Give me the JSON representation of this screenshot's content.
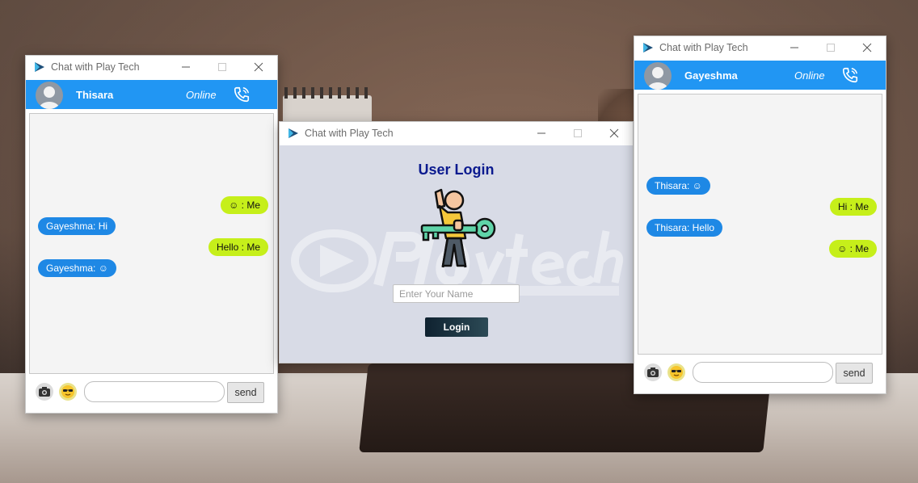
{
  "windows": {
    "left_chat": {
      "title": "Chat with Play Tech",
      "contact_name": "Thisara",
      "status": "Online",
      "messages": [
        {
          "text": "☺ : Me",
          "direction": "out"
        },
        {
          "text": "Gayeshma: Hi",
          "direction": "in"
        },
        {
          "text": "Hello : Me",
          "direction": "out"
        },
        {
          "text": "Gayeshma: ☺",
          "direction": "in"
        }
      ],
      "send_label": "send",
      "input_value": ""
    },
    "login": {
      "title": "Chat with Play Tech",
      "heading": "User Login",
      "name_placeholder": "Enter Your Name",
      "login_label": "Login"
    },
    "right_chat": {
      "title": "Chat with Play Tech",
      "contact_name": "Gayeshma",
      "status": "Online",
      "messages": [
        {
          "text": "Thisara: ☺",
          "direction": "in"
        },
        {
          "text": "Hi : Me",
          "direction": "out"
        },
        {
          "text": "Thisara: Hello",
          "direction": "in"
        },
        {
          "text": "☺ : Me",
          "direction": "out"
        }
      ],
      "send_label": "send",
      "input_value": ""
    }
  },
  "colors": {
    "header_blue": "#2196f3",
    "incoming_bubble": "#1e88e5",
    "outgoing_bubble": "#c6ef1a",
    "login_title": "#0b1a8f"
  },
  "icons": [
    "app-logo-icon",
    "minimize-icon",
    "maximize-icon",
    "close-icon",
    "avatar-icon",
    "phone-call-icon",
    "camera-icon",
    "sunglasses-emoji-icon",
    "key-person-icon"
  ]
}
